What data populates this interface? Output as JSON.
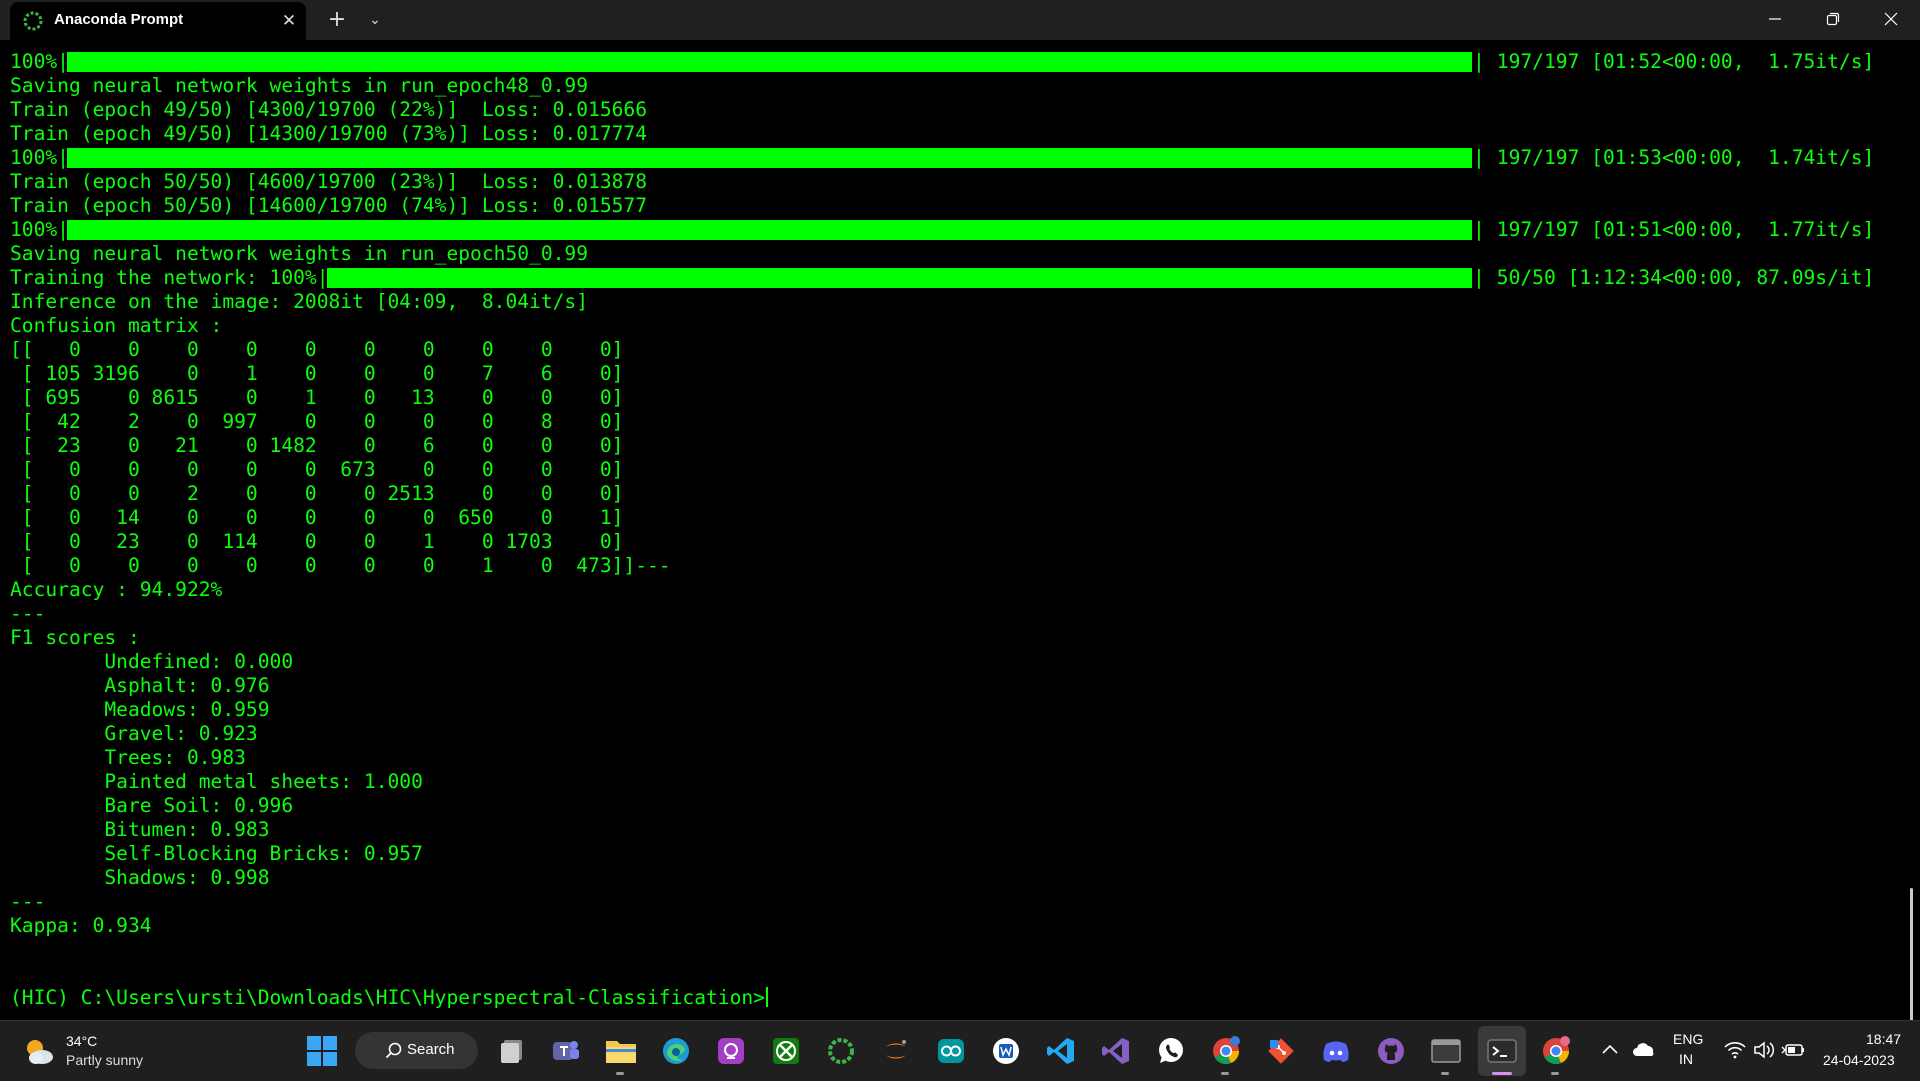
{
  "window": {
    "tab_title": "Anaconda Prompt",
    "close_glyph": "✕",
    "new_tab_glyph": "+",
    "dropdown_glyph": "⌄"
  },
  "terminal": {
    "text_color": "#0dff0d",
    "bar_color": "#00ff00",
    "lines": [
      {
        "type": "bar",
        "prefix": "100%|",
        "suffix": " 197/197 [01:52<00:00,  1.75it/s]",
        "progress": 1.0
      },
      {
        "type": "text",
        "text": "Saving neural network weights in run_epoch48_0.99"
      },
      {
        "type": "text",
        "text": "Train (epoch 49/50) [4300/19700 (22%)]  Loss: 0.015666"
      },
      {
        "type": "text",
        "text": "Train (epoch 49/50) [14300/19700 (73%)] Loss: 0.017774"
      },
      {
        "type": "bar",
        "prefix": "100%|",
        "suffix": " 197/197 [01:53<00:00,  1.74it/s]",
        "progress": 1.0
      },
      {
        "type": "text",
        "text": "Train (epoch 50/50) [4600/19700 (23%)]  Loss: 0.013878"
      },
      {
        "type": "text",
        "text": "Train (epoch 50/50) [14600/19700 (74%)] Loss: 0.015577"
      },
      {
        "type": "bar",
        "prefix": "100%|",
        "suffix": " 197/197 [01:51<00:00,  1.77it/s]",
        "progress": 1.0
      },
      {
        "type": "text",
        "text": "Saving neural network weights in run_epoch50_0.99"
      },
      {
        "type": "bar",
        "prefix": "Training the network: 100%|",
        "suffix": " 50/50 [1:12:34<00:00, 87.09s/it]",
        "progress": 1.0
      },
      {
        "type": "text",
        "text": "Inference on the image: 2008it [04:09,  8.04it/s]"
      },
      {
        "type": "text",
        "text": "Confusion matrix :"
      },
      {
        "type": "text",
        "text": "[[   0    0    0    0    0    0    0    0    0    0]"
      },
      {
        "type": "text",
        "text": " [ 105 3196    0    1    0    0    0    7    6    0]"
      },
      {
        "type": "text",
        "text": " [ 695    0 8615    0    1    0   13    0    0    0]"
      },
      {
        "type": "text",
        "text": " [  42    2    0  997    0    0    0    0    8    0]"
      },
      {
        "type": "text",
        "text": " [  23    0   21    0 1482    0    6    0    0    0]"
      },
      {
        "type": "text",
        "text": " [   0    0    0    0    0  673    0    0    0    0]"
      },
      {
        "type": "text",
        "text": " [   0    0    2    0    0    0 2513    0    0    0]"
      },
      {
        "type": "text",
        "text": " [   0   14    0    0    0    0    0  650    0    1]"
      },
      {
        "type": "text",
        "text": " [   0   23    0  114    0    0    1    0 1703    0]"
      },
      {
        "type": "text",
        "text": " [   0    0    0    0    0    0    0    1    0  473]]---"
      },
      {
        "type": "text",
        "text": "Accuracy : 94.922%"
      },
      {
        "type": "text",
        "text": "---"
      },
      {
        "type": "text",
        "text": "F1 scores :"
      },
      {
        "type": "text",
        "text": "        Undefined: 0.000"
      },
      {
        "type": "text",
        "text": "        Asphalt: 0.976"
      },
      {
        "type": "text",
        "text": "        Meadows: 0.959"
      },
      {
        "type": "text",
        "text": "        Gravel: 0.923"
      },
      {
        "type": "text",
        "text": "        Trees: 0.983"
      },
      {
        "type": "text",
        "text": "        Painted metal sheets: 1.000"
      },
      {
        "type": "text",
        "text": "        Bare Soil: 0.996"
      },
      {
        "type": "text",
        "text": "        Bitumen: 0.983"
      },
      {
        "type": "text",
        "text": "        Self-Blocking Bricks: 0.957"
      },
      {
        "type": "text",
        "text": "        Shadows: 0.998"
      },
      {
        "type": "text",
        "text": "---"
      },
      {
        "type": "text",
        "text": "Kappa: 0.934"
      },
      {
        "type": "text",
        "text": ""
      },
      {
        "type": "text",
        "text": ""
      },
      {
        "type": "prompt",
        "text": "(HIC) C:\\Users\\ursti\\Downloads\\HIC\\Hyperspectral-Classification>"
      }
    ]
  },
  "taskbar": {
    "weather": {
      "temperature": "34°C",
      "description": "Partly sunny"
    },
    "search_label": "Search",
    "apps": [
      "task-view-icon",
      "teams-icon",
      "file-explorer-icon",
      "edge-icon",
      "app-icon",
      "xbox-icon",
      "anaconda-icon",
      "jupyter-icon",
      "arduino-icon",
      "word-icon",
      "vscode-icon",
      "visual-studio-icon",
      "whatsapp-icon",
      "chrome-icon",
      "git-icon",
      "discord-icon",
      "github-icon",
      "console-icon",
      "terminal-icon",
      "chrome-profile-icon"
    ],
    "tray": {
      "language": "ENG",
      "region": "IN",
      "time": "18:47",
      "date": "24-04-2023"
    }
  }
}
